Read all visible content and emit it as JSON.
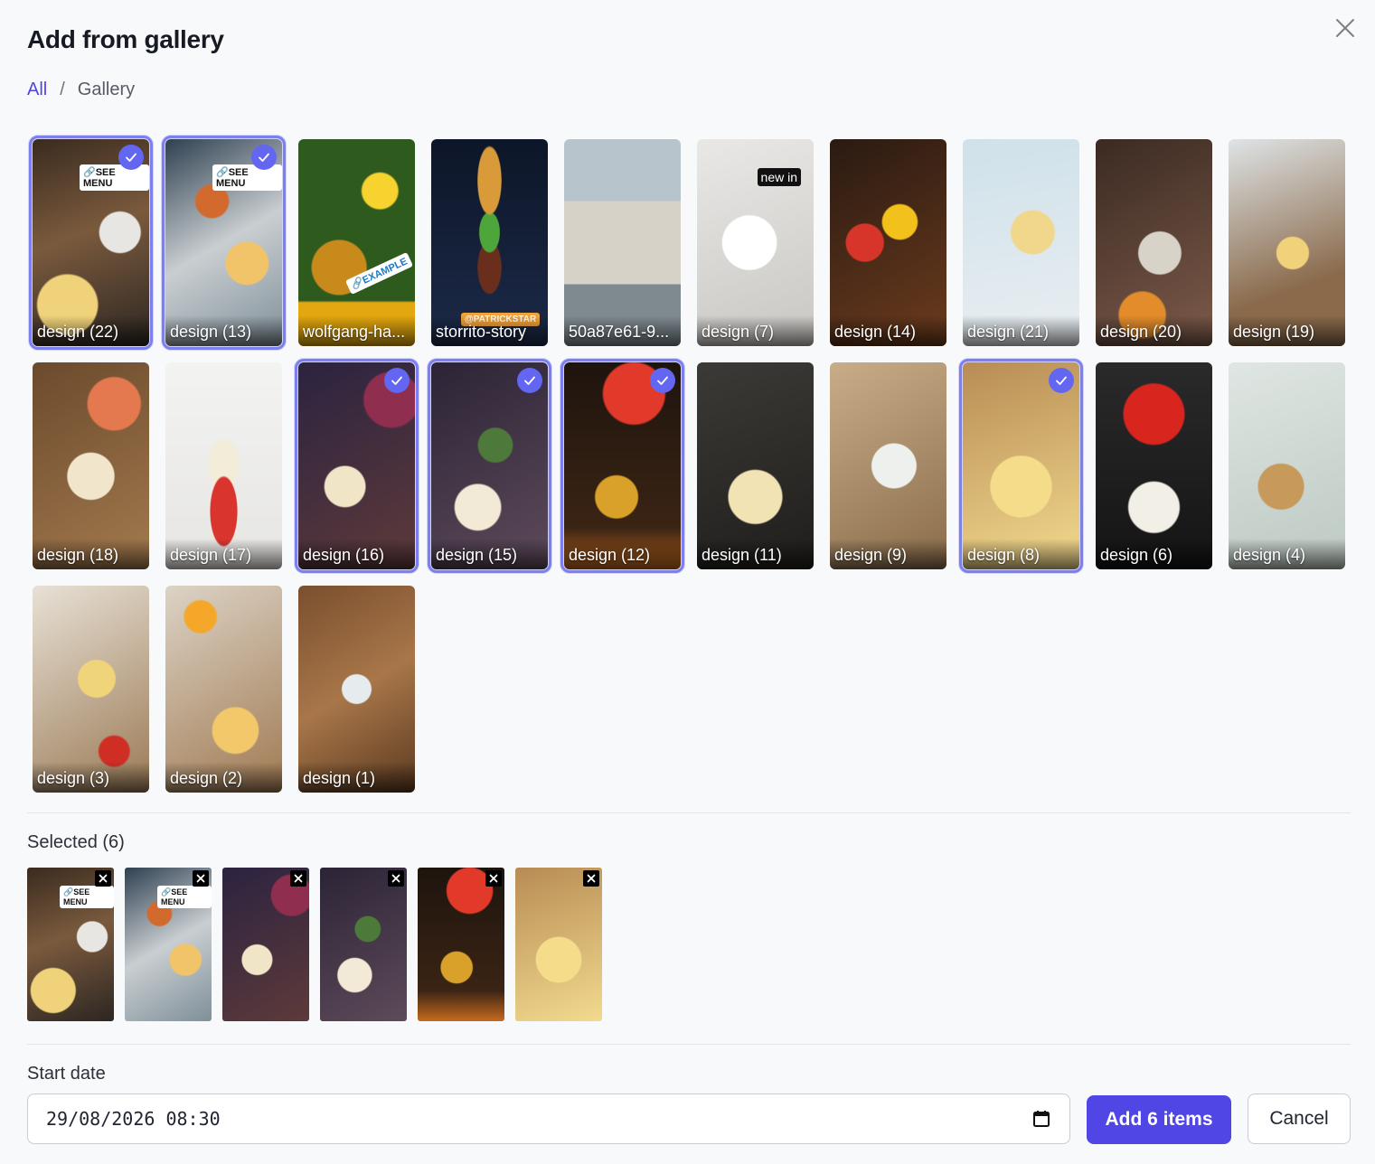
{
  "dialog": {
    "title": "Add from gallery",
    "close_icon": "close-icon"
  },
  "breadcrumb": {
    "root": "All",
    "separator": "/",
    "current": "Gallery"
  },
  "gallery": {
    "items": [
      {
        "label": "design (22)",
        "selected": true,
        "overlay": "🔗SEE MENU"
      },
      {
        "label": "design (13)",
        "selected": true,
        "overlay": "🔗SEE MENU"
      },
      {
        "label": "wolfgang-ha...",
        "selected": false,
        "overlay": "🔗EXAMPLE"
      },
      {
        "label": "storrito-story",
        "selected": false,
        "overlay": "@PATRICKSTAR"
      },
      {
        "label": "50a87e61-9...",
        "selected": false,
        "overlay": ""
      },
      {
        "label": "design (7)",
        "selected": false,
        "overlay": "new in"
      },
      {
        "label": "design (14)",
        "selected": false,
        "overlay": ""
      },
      {
        "label": "design (21)",
        "selected": false,
        "overlay": ""
      },
      {
        "label": "design (20)",
        "selected": false,
        "overlay": ""
      },
      {
        "label": "design (19)",
        "selected": false,
        "overlay": ""
      },
      {
        "label": "design (18)",
        "selected": false,
        "overlay": ""
      },
      {
        "label": "design (17)",
        "selected": false,
        "overlay": ""
      },
      {
        "label": "design (16)",
        "selected": true,
        "overlay": ""
      },
      {
        "label": "design (15)",
        "selected": true,
        "overlay": ""
      },
      {
        "label": "design (12)",
        "selected": true,
        "overlay": ""
      },
      {
        "label": "design (11)",
        "selected": false,
        "overlay": ""
      },
      {
        "label": "design (9)",
        "selected": false,
        "overlay": ""
      },
      {
        "label": "design (8)",
        "selected": true,
        "overlay": ""
      },
      {
        "label": "design (6)",
        "selected": false,
        "overlay": ""
      },
      {
        "label": "design (4)",
        "selected": false,
        "overlay": ""
      },
      {
        "label": "design (3)",
        "selected": false,
        "overlay": ""
      },
      {
        "label": "design (2)",
        "selected": false,
        "overlay": ""
      },
      {
        "label": "design (1)",
        "selected": false,
        "overlay": ""
      }
    ]
  },
  "selection": {
    "title": "Selected (6)",
    "thumb_overlays": [
      "🔗SEE MENU",
      "🔗SEE MENU",
      "",
      "",
      "",
      ""
    ]
  },
  "schedule": {
    "start_label": "Start date",
    "date_value": "29/08/2026  08:30"
  },
  "actions": {
    "add_label": "Add 6 items",
    "cancel_label": "Cancel"
  },
  "colors": {
    "accent": "#4f46e5",
    "selected_outline": "#7b7ff0",
    "background": "#f8f9fb"
  }
}
